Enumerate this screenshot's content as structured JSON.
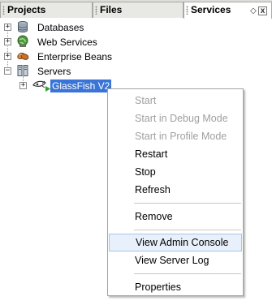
{
  "tabs": [
    {
      "label": "Projects"
    },
    {
      "label": "Files"
    },
    {
      "label": "Services"
    }
  ],
  "tab_controls": {
    "restore_symbol": "◇",
    "close_symbol": "x"
  },
  "tree": {
    "databases": {
      "label": "Databases",
      "icon": "database-icon"
    },
    "web_services": {
      "label": "Web Services",
      "icon": "web-services-icon"
    },
    "enterprise_beans": {
      "label": "Enterprise Beans",
      "icon": "enterprise-beans-icon"
    },
    "servers": {
      "label": "Servers",
      "icon": "servers-icon"
    },
    "glassfish": {
      "label": "GlassFish V2",
      "icon": "glassfish-icon"
    }
  },
  "expander_symbols": {
    "collapsed": "+",
    "expanded": "−"
  },
  "context_menu": {
    "start": "Start",
    "start_debug": "Start in Debug Mode",
    "start_profile": "Start in Profile Mode",
    "restart": "Restart",
    "stop": "Stop",
    "refresh": "Refresh",
    "remove": "Remove",
    "view_admin_console": "View Admin Console",
    "view_server_log": "View Server Log",
    "properties": "Properties"
  },
  "colors": {
    "selection": "#3a74d7",
    "menu_hover": "#e8f0fb",
    "disabled_text": "#a0a0a0"
  }
}
